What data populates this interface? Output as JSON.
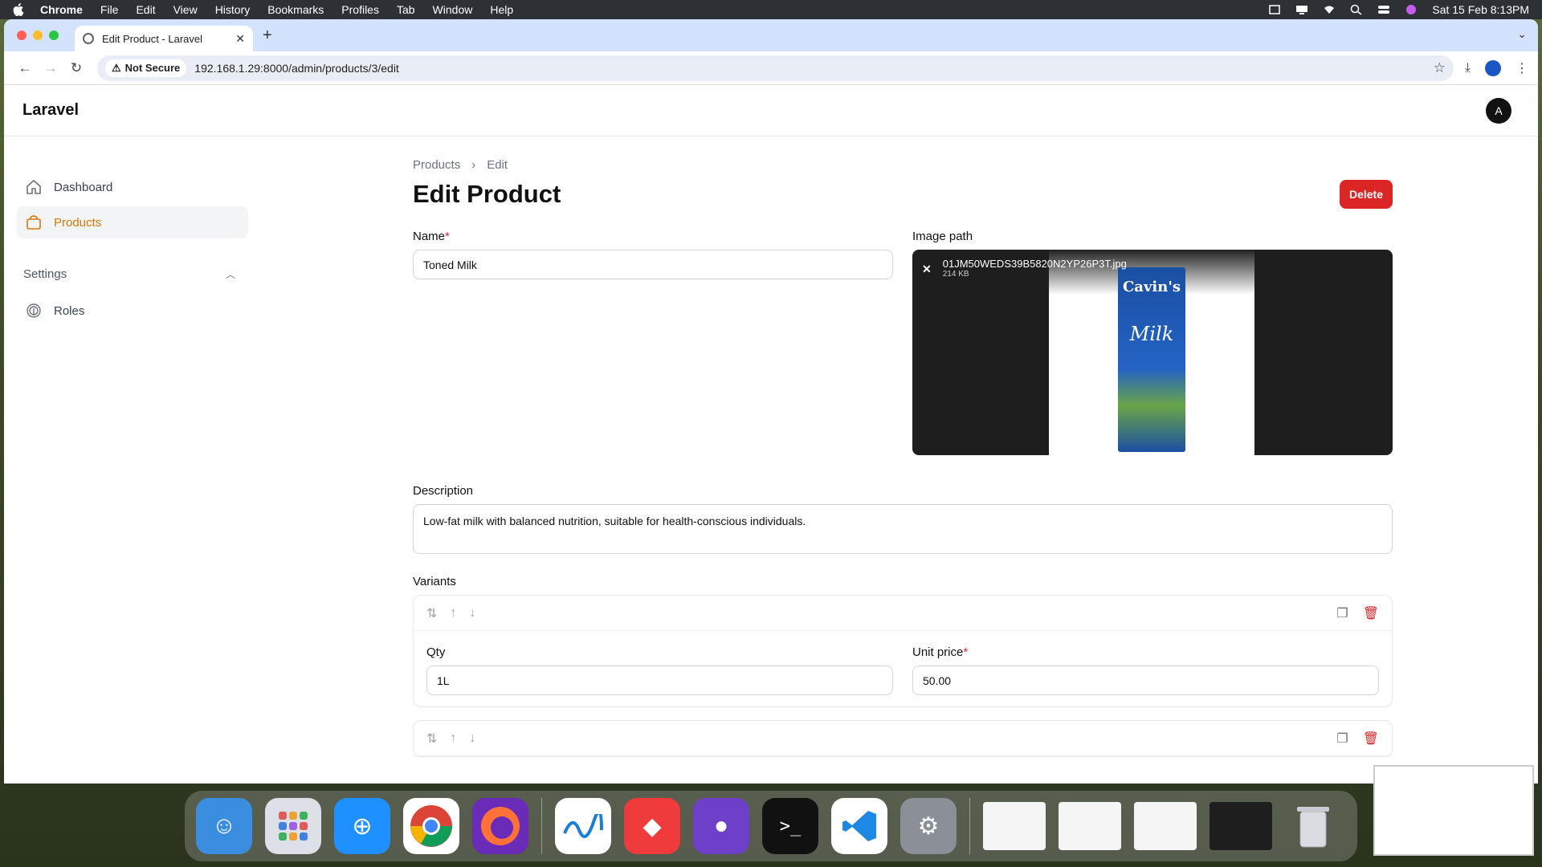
{
  "menubar": {
    "app": "Chrome",
    "items": [
      "File",
      "Edit",
      "View",
      "History",
      "Bookmarks",
      "Profiles",
      "Tab",
      "Window",
      "Help"
    ],
    "datetime": "Sat 15 Feb  8:13PM"
  },
  "browser": {
    "tab_title": "Edit Product - Laravel",
    "security_label": "Not Secure",
    "url": "192.168.1.29:8000/admin/products/3/edit"
  },
  "app": {
    "brand": "Laravel",
    "avatar_initial": "A"
  },
  "sidebar": {
    "items": [
      {
        "label": "Dashboard",
        "icon": "home-icon"
      },
      {
        "label": "Products",
        "icon": "shopping-bag-icon",
        "active": true
      }
    ],
    "group_label": "Settings",
    "group_items": [
      {
        "label": "Roles",
        "icon": "fingerprint-icon"
      }
    ]
  },
  "page": {
    "breadcrumb": [
      "Products",
      "Edit"
    ],
    "title": "Edit Product",
    "delete_label": "Delete",
    "name_label": "Name",
    "name_value": "Toned Milk",
    "image_label": "Image path",
    "image_file_name": "01JM50WEDS39B5820N2YP26P3T.jpg",
    "image_file_size": "214 KB",
    "image_brand_text": "Cavin's",
    "image_product_text": "Milk",
    "description_label": "Description",
    "description_value": "Low-fat milk with balanced nutrition, suitable for health-conscious individuals.",
    "variants_label": "Variants",
    "variants": [
      {
        "qty_label": "Qty",
        "qty_value": "1L",
        "price_label": "Unit price",
        "price_value": "50.00"
      }
    ]
  },
  "colors": {
    "accent": "#d97706",
    "danger": "#dc2626"
  }
}
